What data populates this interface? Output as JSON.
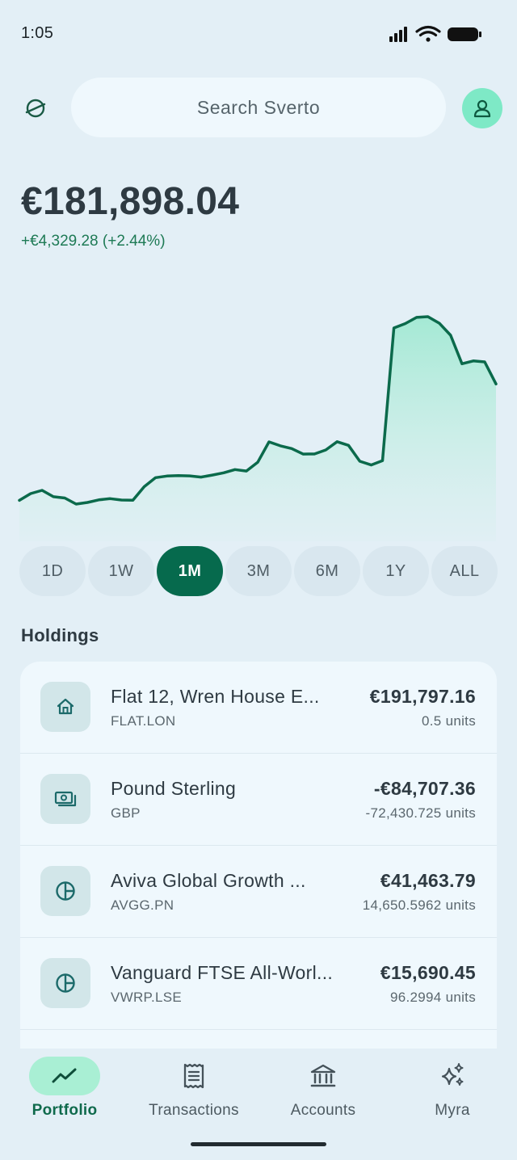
{
  "status": {
    "time": "1:05"
  },
  "search": {
    "placeholder": "Search Sverto"
  },
  "portfolio": {
    "balance": "€181,898.04",
    "change": "+€4,329.28 (+2.44%)",
    "accent_color": "#066a4d",
    "positive_color": "#1e7a55"
  },
  "chart_data": {
    "type": "area",
    "series": [
      {
        "values": [
          0.5,
          7.2,
          10.4,
          4.1,
          2.8,
          -3.2,
          -1.6,
          1.0,
          2.2,
          0.8,
          0.6,
          14.0,
          23.0,
          24.6,
          25.0,
          24.7,
          23.5,
          25.5,
          27.8,
          31.0,
          29.5,
          38.2,
          58.4,
          54.5,
          51.8,
          46.3,
          46.4,
          50.4,
          58.6,
          55.0,
          39.2,
          35.5,
          39.8,
          171.2,
          175.5,
          181.7,
          182.4,
          175.9,
          164.0,
          135.8,
          138.6,
          137.6,
          115.8
        ]
      }
    ]
  },
  "ranges": [
    {
      "label": "1D",
      "active": false
    },
    {
      "label": "1W",
      "active": false
    },
    {
      "label": "1M",
      "active": true
    },
    {
      "label": "3M",
      "active": false
    },
    {
      "label": "6M",
      "active": false
    },
    {
      "label": "1Y",
      "active": false
    },
    {
      "label": "ALL",
      "active": false
    }
  ],
  "holdings": {
    "title": "Holdings",
    "items": [
      {
        "icon": "home-icon",
        "name": "Flat 12, Wren House E...",
        "ticker": "FLAT.LON",
        "value": "€191,797.16",
        "units": "0.5 units"
      },
      {
        "icon": "cash-icon",
        "name": "Pound Sterling",
        "ticker": "GBP",
        "value": "-€84,707.36",
        "units": "-72,430.725 units"
      },
      {
        "icon": "pie-chart-icon",
        "name": "Aviva Global Growth ...",
        "ticker": "AVGG.PN",
        "value": "€41,463.79",
        "units": "14,650.5962 units"
      },
      {
        "icon": "pie-chart-icon",
        "name": "Vanguard FTSE All-Worl...",
        "ticker": "VWRP.LSE",
        "value": "€15,690.45",
        "units": "96.2994 units"
      }
    ]
  },
  "nav": {
    "items": [
      {
        "label": "Portfolio",
        "icon": "trending-up-icon",
        "active": true
      },
      {
        "label": "Transactions",
        "icon": "receipt-icon",
        "active": false
      },
      {
        "label": "Accounts",
        "icon": "bank-icon",
        "active": false
      },
      {
        "label": "Myra",
        "icon": "sparkles-icon",
        "active": false
      }
    ]
  }
}
